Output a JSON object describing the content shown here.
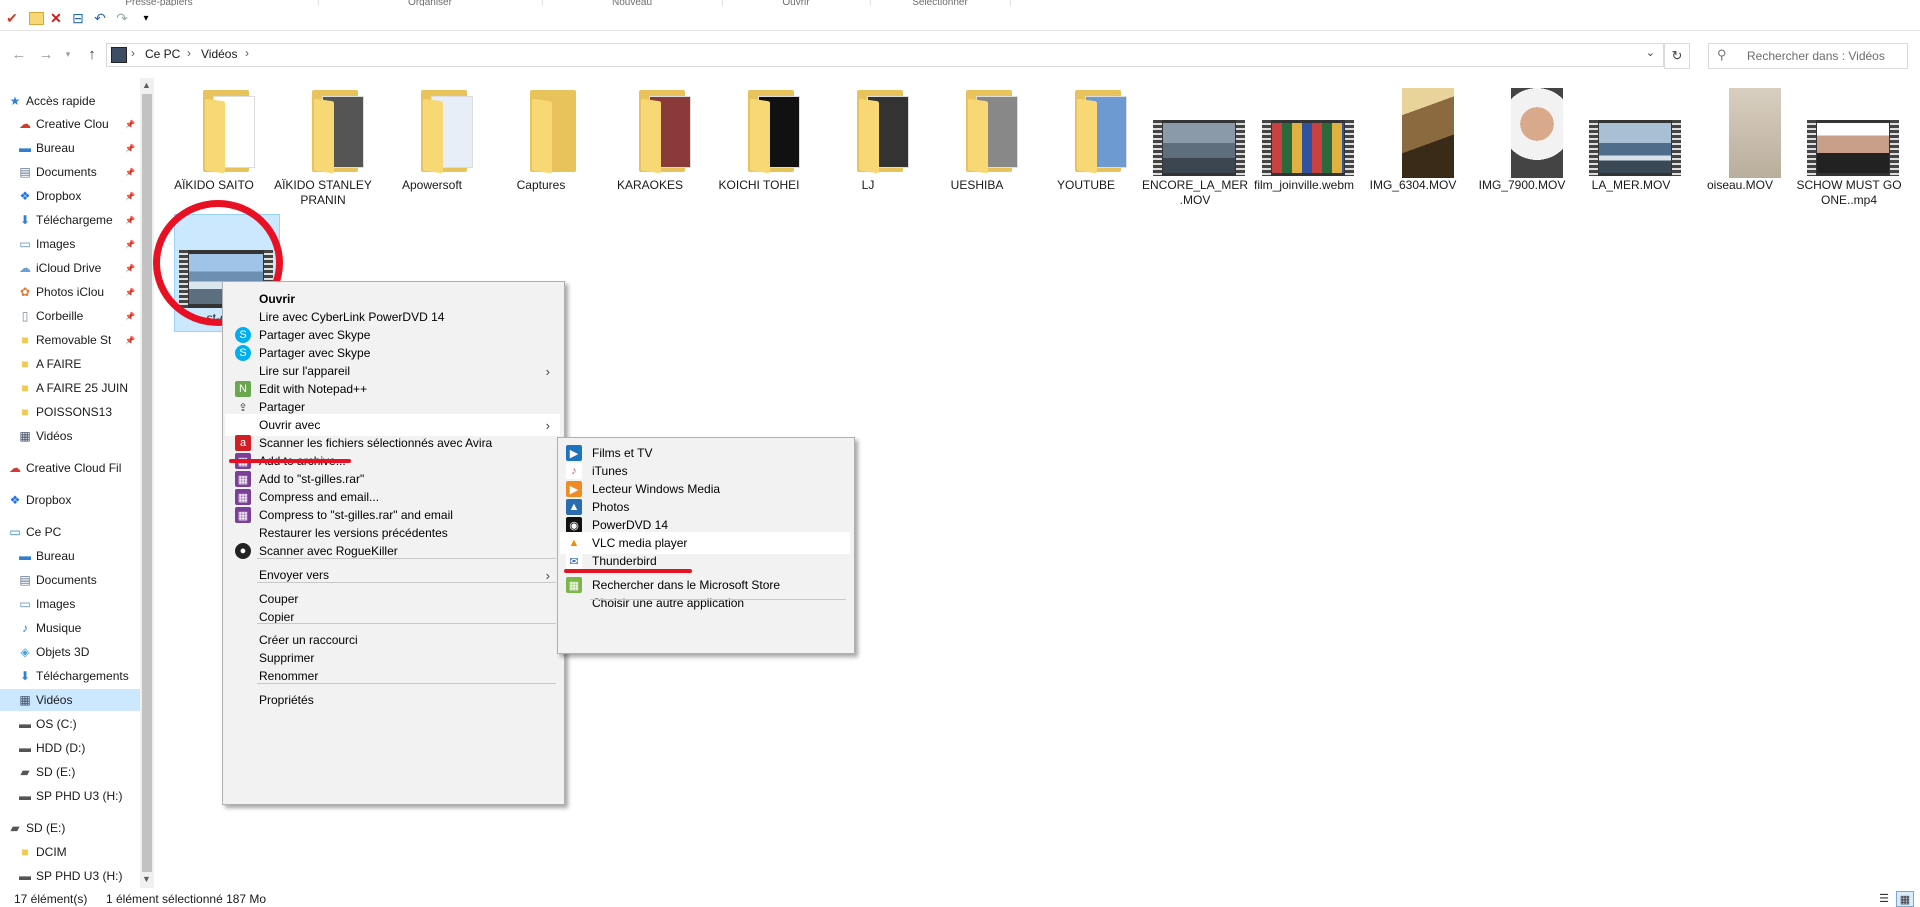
{
  "ribbon": {
    "groups": [
      "Presse-papiers",
      "Organiser",
      "Nouveau",
      "Ouvrir",
      "Sélectionner"
    ],
    "qat_icons": [
      "properties-icon",
      "new-folder-icon",
      "delete-icon",
      "rename-icon",
      "undo-icon",
      "redo-icon",
      "customize-icon"
    ]
  },
  "address": {
    "crumbs": [
      "Ce PC",
      "Vidéos"
    ],
    "search_placeholder": "Rechercher dans : Vidéos"
  },
  "sidebar": {
    "items": [
      {
        "label": "Accès rapide",
        "icon": "star-icon"
      },
      {
        "label": "Creative Clou",
        "icon": "creative-cloud-icon",
        "pinned": true
      },
      {
        "label": "Bureau",
        "icon": "desktop-icon",
        "pinned": true
      },
      {
        "label": "Documents",
        "icon": "documents-icon",
        "pinned": true
      },
      {
        "label": "Dropbox",
        "icon": "dropbox-icon",
        "pinned": true
      },
      {
        "label": "Téléchargeme",
        "icon": "download-icon",
        "pinned": true
      },
      {
        "label": "Images",
        "icon": "images-icon",
        "pinned": true
      },
      {
        "label": "iCloud Drive",
        "icon": "icloud-icon",
        "pinned": true
      },
      {
        "label": "Photos iClou",
        "icon": "icloud-photos-icon",
        "pinned": true
      },
      {
        "label": "Corbeille",
        "icon": "recycle-bin-icon",
        "pinned": true
      },
      {
        "label": "Removable St",
        "icon": "folder-icon",
        "pinned": true
      },
      {
        "label": "A FAIRE",
        "icon": "folder-icon"
      },
      {
        "label": "A FAIRE 25 JUIN",
        "icon": "folder-icon"
      },
      {
        "label": "POISSONS13",
        "icon": "folder-icon"
      },
      {
        "label": "Vidéos",
        "icon": "videos-icon"
      },
      {
        "label": "Creative Cloud Fil",
        "icon": "creative-cloud-icon"
      },
      {
        "label": "Dropbox",
        "icon": "dropbox-icon"
      },
      {
        "label": "Ce PC",
        "icon": "pc-icon"
      },
      {
        "label": "Bureau",
        "icon": "desktop-icon"
      },
      {
        "label": "Documents",
        "icon": "documents-icon"
      },
      {
        "label": "Images",
        "icon": "images-icon"
      },
      {
        "label": "Musique",
        "icon": "music-icon"
      },
      {
        "label": "Objets 3D",
        "icon": "objects-3d-icon"
      },
      {
        "label": "Téléchargements",
        "icon": "download-icon"
      },
      {
        "label": "Vidéos",
        "icon": "videos-icon",
        "selected": true
      },
      {
        "label": "OS (C:)",
        "icon": "drive-icon"
      },
      {
        "label": "HDD (D:)",
        "icon": "drive-icon"
      },
      {
        "label": "SD (E:)",
        "icon": "sd-card-icon"
      },
      {
        "label": "SP PHD U3 (H:)",
        "icon": "drive-icon"
      },
      {
        "label": "SD (E:)",
        "icon": "sd-card-icon"
      },
      {
        "label": "DCIM",
        "icon": "folder-icon"
      },
      {
        "label": "SP PHD U3 (H:)",
        "icon": "drive-icon"
      }
    ]
  },
  "files": [
    {
      "name": "AÏKIDO SAITO",
      "kind": "folder"
    },
    {
      "name": "AÏKIDO STANLEY PRANIN",
      "kind": "folder"
    },
    {
      "name": "Apowersoft",
      "kind": "folder"
    },
    {
      "name": "Captures",
      "kind": "folder"
    },
    {
      "name": "KARAOKES",
      "kind": "folder"
    },
    {
      "name": "KOICHI TOHEI",
      "kind": "folder"
    },
    {
      "name": "LJ",
      "kind": "folder"
    },
    {
      "name": "UESHIBA",
      "kind": "folder"
    },
    {
      "name": "YOUTUBE",
      "kind": "folder"
    },
    {
      "name": "ENCORE_LA_MER.MOV",
      "kind": "video"
    },
    {
      "name": "film_joinville.webm",
      "kind": "video"
    },
    {
      "name": "IMG_6304.MOV",
      "kind": "portrait"
    },
    {
      "name": "IMG_7900.MOV",
      "kind": "portrait"
    },
    {
      "name": "LA_MER.MOV",
      "kind": "video"
    },
    {
      "name": "oiseau.MOV",
      "kind": "portrait"
    },
    {
      "name": "SCHOW MUST GO ONE..mp4",
      "kind": "video"
    },
    {
      "name": "st-gilles",
      "kind": "video"
    }
  ],
  "context_menu": {
    "items": [
      {
        "label": "Ouvrir",
        "bold": true
      },
      {
        "label": "Lire avec CyberLink PowerDVD 14"
      },
      {
        "label": "Partager avec Skype",
        "icon": "skype-icon"
      },
      {
        "label": "Partager avec Skype",
        "icon": "skype-icon"
      },
      {
        "label": "Lire sur l'appareil",
        "submenu": true
      },
      {
        "label": "Edit with Notepad++",
        "icon": "notepadpp-icon"
      },
      {
        "label": "Partager",
        "icon": "share-icon"
      },
      {
        "label": "Ouvrir avec",
        "submenu": true,
        "highlighted": true
      },
      {
        "label": "Scanner les fichiers sélectionnés avec Avira",
        "icon": "avira-icon"
      },
      {
        "label": "Add to archive...",
        "icon": "winrar-icon"
      },
      {
        "label": "Add to \"st-gilles.rar\"",
        "icon": "winrar-icon"
      },
      {
        "label": "Compress and email...",
        "icon": "winrar-icon"
      },
      {
        "label": "Compress to \"st-gilles.rar\" and email",
        "icon": "winrar-icon"
      },
      {
        "label": "Restaurer les versions précédentes"
      },
      {
        "label": "Scanner avec RogueKiller",
        "icon": "roguekiller-icon"
      },
      {
        "label": "Envoyer vers",
        "submenu": true
      },
      {
        "label": "Couper"
      },
      {
        "label": "Copier"
      },
      {
        "label": "Créer un raccourci"
      },
      {
        "label": "Supprimer"
      },
      {
        "label": "Renommer"
      },
      {
        "label": "Propriétés"
      }
    ]
  },
  "open_with_menu": {
    "items": [
      {
        "label": "Films et TV",
        "icon": "films-tv-icon"
      },
      {
        "label": "iTunes",
        "icon": "itunes-icon"
      },
      {
        "label": "Lecteur Windows Media",
        "icon": "windows-media-icon"
      },
      {
        "label": "Photos",
        "icon": "photos-icon"
      },
      {
        "label": "PowerDVD 14",
        "icon": "powerdvd-icon"
      },
      {
        "label": "VLC media player",
        "icon": "vlc-icon",
        "highlighted": true
      },
      {
        "label": "Thunderbird",
        "icon": "thunderbird-icon"
      },
      {
        "label": "Rechercher dans le Microsoft Store",
        "icon": "store-icon"
      },
      {
        "label": "Choisir une autre application"
      }
    ]
  },
  "status": {
    "count": "17 élément(s)",
    "selection": "1 élément sélectionné  187 Mo"
  },
  "colors": {
    "selection": "#cce8ff",
    "annotation": "#e81123",
    "folder": "#f8d775"
  }
}
